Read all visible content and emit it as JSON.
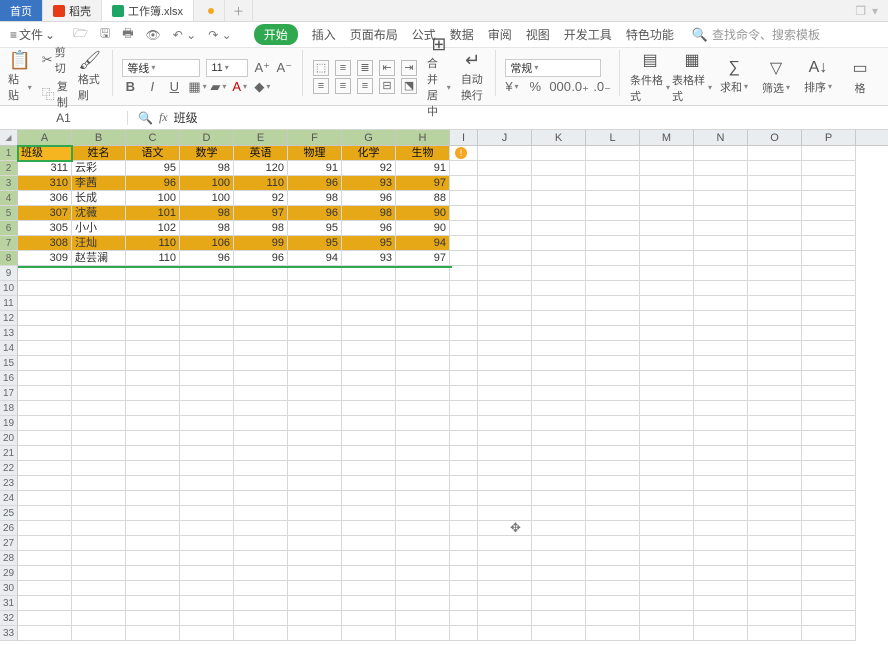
{
  "tabs": {
    "home": "首页",
    "docker": "稻壳",
    "workbook": "工作簿.xlsx"
  },
  "file_menu": "文件",
  "ribbon": [
    "开始",
    "插入",
    "页面布局",
    "公式",
    "数据",
    "审阅",
    "视图",
    "开发工具",
    "特色功能"
  ],
  "search_placeholder": "查找命令、搜索模板",
  "clipboard": {
    "paste": "粘贴",
    "cut": "剪切",
    "copy": "复制",
    "format": "格式刷"
  },
  "font": {
    "name": "等线",
    "size": "11"
  },
  "merge": "合并居中",
  "wrap": "自动换行",
  "numfmt": "常规",
  "right": {
    "cond": "条件格式",
    "tstyle": "表格样式",
    "sum": "求和",
    "filter": "筛选",
    "sort": "排序",
    "g": "格"
  },
  "namebox": "A1",
  "fx_value": "班级",
  "cols": [
    "A",
    "B",
    "C",
    "D",
    "E",
    "F",
    "G",
    "H",
    "I",
    "J",
    "K",
    "L",
    "M",
    "N",
    "O",
    "P"
  ],
  "header": [
    "班级",
    "姓名",
    "语文",
    "数学",
    "英语",
    "物理",
    "化学",
    "生物"
  ],
  "data": [
    [
      311,
      "云彩",
      95,
      98,
      120,
      91,
      92,
      91
    ],
    [
      310,
      "李茜",
      96,
      100,
      110,
      96,
      93,
      97
    ],
    [
      306,
      "长成",
      100,
      100,
      92,
      98,
      96,
      88
    ],
    [
      307,
      "沈薇",
      101,
      98,
      97,
      96,
      98,
      90
    ],
    [
      305,
      "小小",
      102,
      98,
      98,
      95,
      96,
      90
    ],
    [
      308,
      "汪灿",
      110,
      106,
      99,
      95,
      95,
      94
    ],
    [
      309,
      "赵芸澜",
      110,
      96,
      96,
      94,
      93,
      97
    ]
  ],
  "empty_rows": 25
}
